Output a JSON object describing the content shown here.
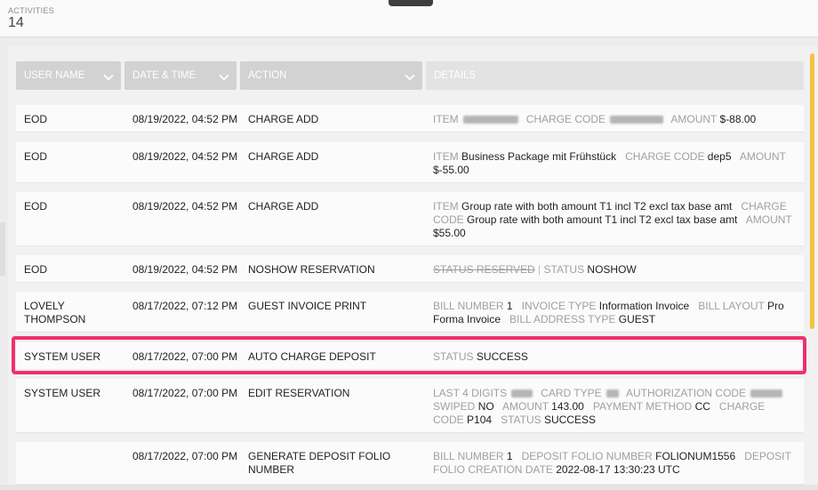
{
  "activities": {
    "label": "ACTIVITIES",
    "count": "14"
  },
  "columns": {
    "user": "USER NAME",
    "datetime": "DATE & TIME",
    "action": "ACTION",
    "details": "DETAILS"
  },
  "rows": [
    {
      "user": "EOD",
      "datetime": "08/19/2022, 04:52 PM",
      "action": "CHARGE ADD",
      "d": {
        "item_k": "ITEM",
        "code_k": "CHARGE CODE",
        "amount_k": "AMOUNT",
        "amount_v": "$-88.00"
      }
    },
    {
      "user": "EOD",
      "datetime": "08/19/2022, 04:52 PM",
      "action": "CHARGE ADD",
      "d": {
        "item_k": "ITEM",
        "item_v": "Business Package mit Frühstück",
        "code_k": "CHARGE CODE",
        "code_v": "dep5",
        "amount_k": "AMOUNT",
        "amount_v": "$-55.00"
      }
    },
    {
      "user": "EOD",
      "datetime": "08/19/2022, 04:52 PM",
      "action": "CHARGE ADD",
      "d": {
        "item_k": "ITEM",
        "item_v": "Group rate with both amount T1 incl T2 excl tax base amt",
        "code_k": "CHARGE CODE",
        "code_v": "Group rate with both amount T1 incl T2 excl tax base amt",
        "amount_k": "AMOUNT",
        "amount_v": "$55.00"
      }
    },
    {
      "user": "EOD",
      "datetime": "08/19/2022, 04:52 PM",
      "action": "NOSHOW RESERVATION",
      "d": {
        "old_status": "STATUS RESERVED",
        "status_k": "STATUS",
        "status_v": "NOSHOW"
      }
    },
    {
      "user": "LOVELY THOMPSON",
      "datetime": "08/17/2022, 07:12 PM",
      "action": "GUEST INVOICE PRINT",
      "d": {
        "bill_k": "BILL NUMBER",
        "bill_v": "1",
        "inv_k": "INVOICE TYPE",
        "inv_v": "Information Invoice",
        "layout_k": "BILL LAYOUT",
        "layout_v": "Pro Forma Invoice",
        "addr_k": "BILL ADDRESS TYPE",
        "addr_v": "GUEST"
      }
    },
    {
      "user": "SYSTEM USER",
      "datetime": "08/17/2022, 07:00 PM",
      "action": "AUTO CHARGE DEPOSIT",
      "d": {
        "status_k": "STATUS",
        "status_v": "SUCCESS"
      }
    },
    {
      "user": "SYSTEM USER",
      "datetime": "08/17/2022, 07:00 PM",
      "action": "EDIT RESERVATION",
      "d": {
        "last4_k": "LAST 4 DIGITS",
        "card_k": "CARD TYPE",
        "auth_k": "AUTHORIZATION CODE",
        "swiped_k": "SWIPED",
        "swiped_v": "NO",
        "amount_k": "AMOUNT",
        "amount_v": "143.00",
        "pm_k": "PAYMENT METHOD",
        "pm_v": "CC",
        "code_k": "CHARGE CODE",
        "code_v": "P104",
        "status_k": "STATUS",
        "status_v": "SUCCESS"
      }
    },
    {
      "user": "",
      "datetime": "08/17/2022, 07:00 PM",
      "action": "GENERATE DEPOSIT FOLIO NUMBER",
      "d": {
        "bill_k": "BILL NUMBER",
        "bill_v": "1",
        "folio_k": "DEPOSIT FOLIO NUMBER",
        "folio_v": "FOLIONUM1556",
        "cdate_k": "DEPOSIT FOLIO CREATION DATE",
        "cdate_v": "2022-08-17 13:30:23 UTC"
      }
    }
  ]
}
